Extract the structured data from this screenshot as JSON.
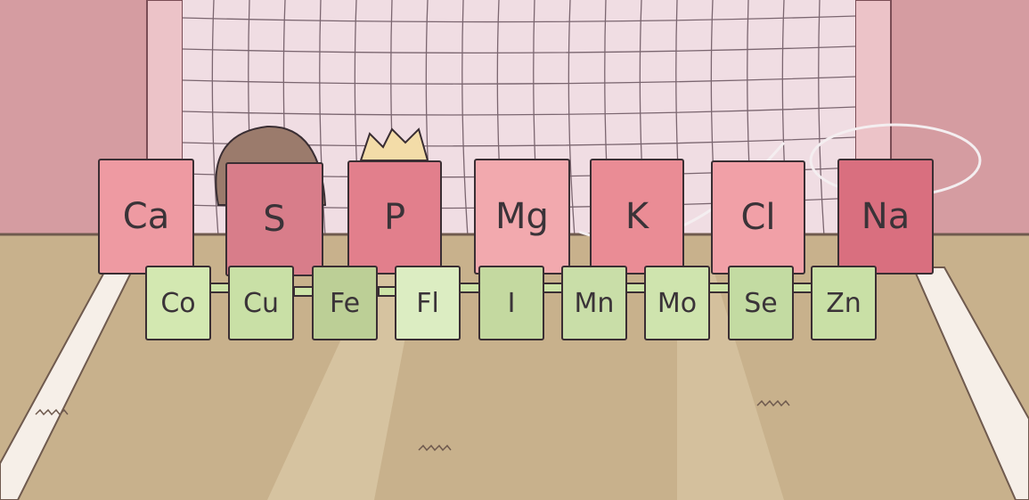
{
  "colors": {
    "wall": "#d9a3a6",
    "net_bg": "#f1dde3",
    "floor": "#c9b28e",
    "red_tile": "#e88f98",
    "green_tile": "#cfe5ad"
  },
  "macro_elements": [
    {
      "symbol": "Ca",
      "color": "#ee9aa2"
    },
    {
      "symbol": "S",
      "color": "#d87d8a"
    },
    {
      "symbol": "P",
      "color": "#e27f8c"
    },
    {
      "symbol": "Mg",
      "color": "#f2a9ae"
    },
    {
      "symbol": "K",
      "color": "#ea8c95"
    },
    {
      "symbol": "Cl",
      "color": "#f1a0a7"
    },
    {
      "symbol": "Na",
      "color": "#d96f7f"
    }
  ],
  "trace_elements": [
    {
      "symbol": "Co",
      "color": "#d3e8b1"
    },
    {
      "symbol": "Cu",
      "color": "#c9e0a6"
    },
    {
      "symbol": "Fe",
      "color": "#bccf96"
    },
    {
      "symbol": "Fl",
      "color": "#dcedc2"
    },
    {
      "symbol": "I",
      "color": "#c4d9a0"
    },
    {
      "symbol": "Mn",
      "color": "#c9dea8"
    },
    {
      "symbol": "Mo",
      "color": "#cfe4ae"
    },
    {
      "symbol": "Se",
      "color": "#c3dba2"
    },
    {
      "symbol": "Zn",
      "color": "#c9e0a6"
    }
  ]
}
